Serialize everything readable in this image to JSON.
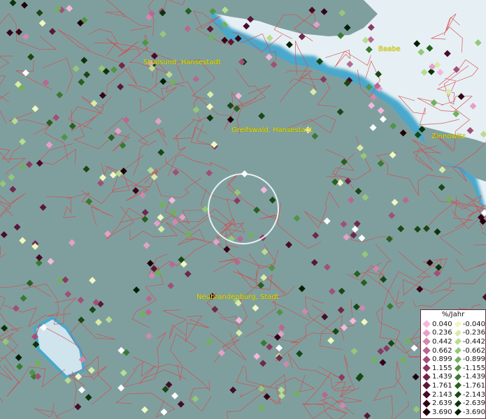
{
  "map": {
    "cities": [
      {
        "name": "Stralsund, Hansestadt"
      },
      {
        "name": "Greifswald, Hansestadt"
      },
      {
        "name": "Zinnowitz"
      },
      {
        "name": "Baabe"
      },
      {
        "name": "Neubrandenburg, Stadt"
      }
    ],
    "colors": {
      "land": "#7f9f9f",
      "water": "#e6f0f4",
      "coast": "#48a8cc",
      "borders": "#d84848"
    }
  },
  "legend": {
    "title": "%/Jahr",
    "increase": [
      {
        "label": "0.040",
        "color": "#f4b8dc"
      },
      {
        "label": "0.236",
        "color": "#e6a0c8"
      },
      {
        "label": "0.442",
        "color": "#d088ac"
      },
      {
        "label": "0.662",
        "color": "#b86890"
      },
      {
        "label": "0.899",
        "color": "#a05078"
      },
      {
        "label": "1.155",
        "color": "#883a60"
      },
      {
        "label": "1.439",
        "color": "#70284a"
      },
      {
        "label": "1.761",
        "color": "#5a1838"
      },
      {
        "label": "2.143",
        "color": "#460c28"
      },
      {
        "label": "2.639",
        "color": "#340418"
      },
      {
        "label": "3.690",
        "color": "#200008"
      }
    ],
    "decrease": [
      {
        "label": "-0.040",
        "color": "#f0f8c0"
      },
      {
        "label": "-0.236",
        "color": "#d8eca8"
      },
      {
        "label": "-0.442",
        "color": "#b8dc90"
      },
      {
        "label": "-0.662",
        "color": "#94c878"
      },
      {
        "label": "-0.899",
        "color": "#72b05c"
      },
      {
        "label": "-1.155",
        "color": "#529444"
      },
      {
        "label": "-1.439",
        "color": "#3a7a30"
      },
      {
        "label": "-1.761",
        "color": "#286020"
      },
      {
        "label": "-2.143",
        "color": "#184814"
      },
      {
        "label": "-2.639",
        "color": "#0c340a"
      },
      {
        "label": "-3.690",
        "color": "#042004"
      }
    ]
  }
}
